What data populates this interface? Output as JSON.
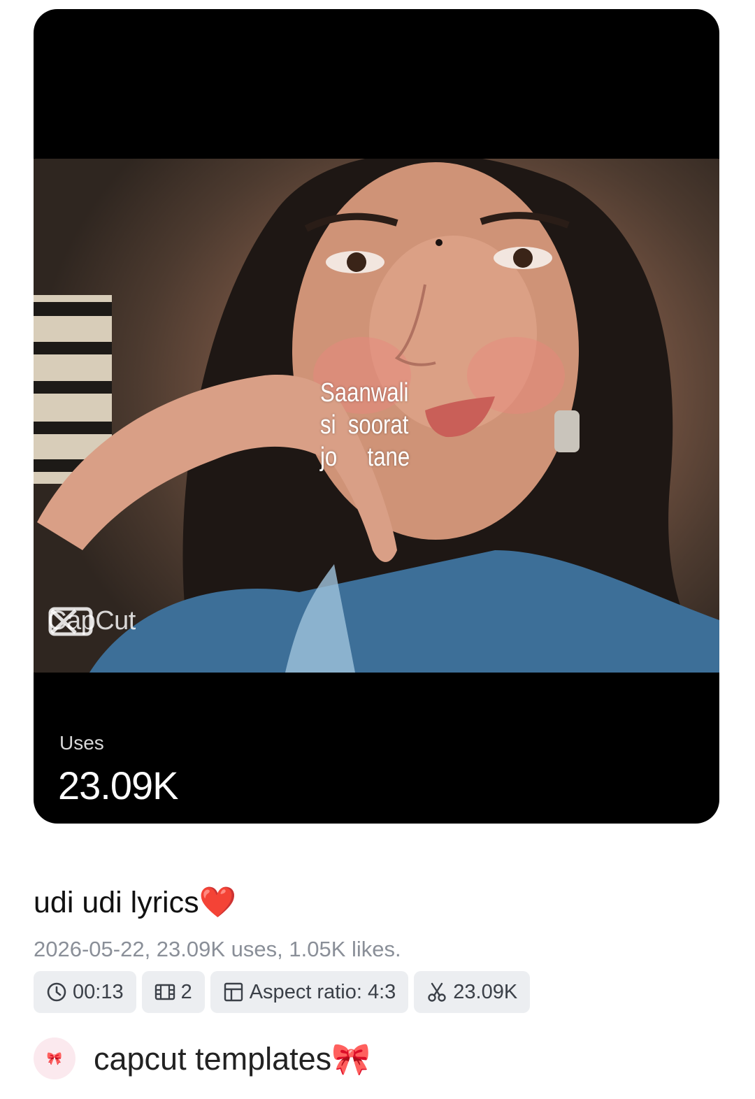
{
  "preview": {
    "lyrics": "Saanwali\nsi  soorat\njo     tane",
    "watermark": "CapCut"
  },
  "stats": {
    "uses_label": "Uses",
    "uses_value": "23.09K"
  },
  "template": {
    "title": "udi udi lyrics❤️",
    "meta": "2026-05-22, 23.09K uses, 1.05K likes."
  },
  "chips": [
    {
      "icon": "clock-icon",
      "label": "00:13"
    },
    {
      "icon": "film-icon",
      "label": "2"
    },
    {
      "icon": "layout-icon",
      "label": "Aspect ratio: 4:3"
    },
    {
      "icon": "scissors-icon",
      "label": "23.09K"
    }
  ],
  "author": {
    "avatar": "🎀",
    "name": "capcut templates🎀"
  },
  "colors": {
    "card_bg": "#000000",
    "chip_bg": "#eceef1",
    "meta_text": "#8a8f98"
  }
}
